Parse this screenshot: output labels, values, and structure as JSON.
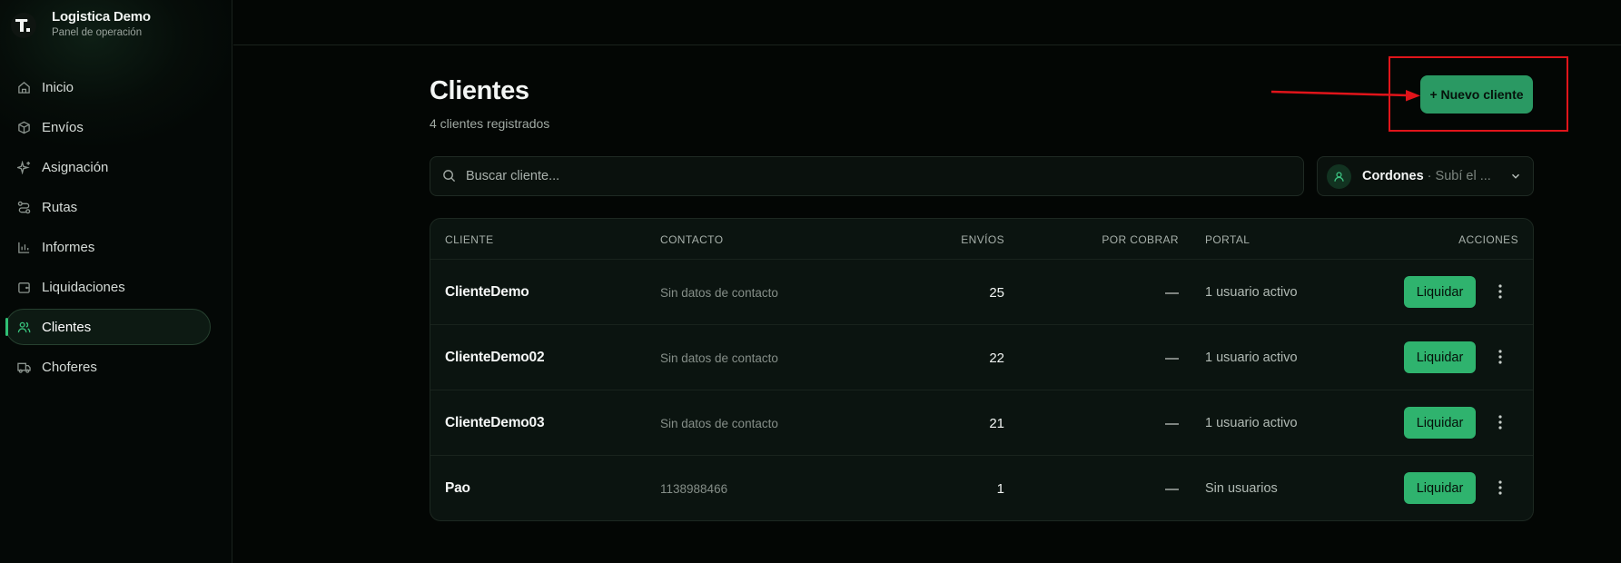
{
  "app": {
    "title": "Logistica Demo",
    "subtitle": "Panel de operación"
  },
  "sidebar": {
    "items": [
      {
        "label": "Inicio",
        "icon": "home-icon",
        "active": false
      },
      {
        "label": "Envíos",
        "icon": "package-icon",
        "active": false
      },
      {
        "label": "Asignación",
        "icon": "sparkle-icon",
        "active": false
      },
      {
        "label": "Rutas",
        "icon": "route-icon",
        "active": false
      },
      {
        "label": "Informes",
        "icon": "bar-chart-icon",
        "active": false
      },
      {
        "label": "Liquidaciones",
        "icon": "wallet-icon",
        "active": false
      },
      {
        "label": "Clientes",
        "icon": "users-icon",
        "active": true
      },
      {
        "label": "Choferes",
        "icon": "truck-icon",
        "active": false
      }
    ]
  },
  "main": {
    "title": "Clientes",
    "subtitle": "4 clientes registrados",
    "new_button": "+ Nuevo cliente",
    "search": {
      "placeholder": "Buscar cliente..."
    },
    "selector": {
      "name": "Cordones",
      "desc": "· Subí el ..."
    }
  },
  "table": {
    "headers": {
      "cliente": "CLIENTE",
      "contacto": "CONTACTO",
      "envios": "ENVÍOS",
      "por_cobrar": "POR COBRAR",
      "portal": "PORTAL",
      "acciones": "ACCIONES"
    },
    "rows": [
      {
        "name": "ClienteDemo",
        "contact": "Sin datos de contacto",
        "envios": "25",
        "por_cobrar": "—",
        "portal": "1 usuario activo",
        "action": "Liquidar"
      },
      {
        "name": "ClienteDemo02",
        "contact": "Sin datos de contacto",
        "envios": "22",
        "por_cobrar": "—",
        "portal": "1 usuario activo",
        "action": "Liquidar"
      },
      {
        "name": "ClienteDemo03",
        "contact": "Sin datos de contacto",
        "envios": "21",
        "por_cobrar": "—",
        "portal": "1 usuario activo",
        "action": "Liquidar"
      },
      {
        "name": "Pao",
        "contact": "1138988466",
        "envios": "1",
        "por_cobrar": "—",
        "portal": "Sin usuarios",
        "action": "Liquidar"
      }
    ]
  },
  "colors": {
    "accent": "#2fb36e",
    "annotation": "#e0141a",
    "background": "#030604"
  }
}
